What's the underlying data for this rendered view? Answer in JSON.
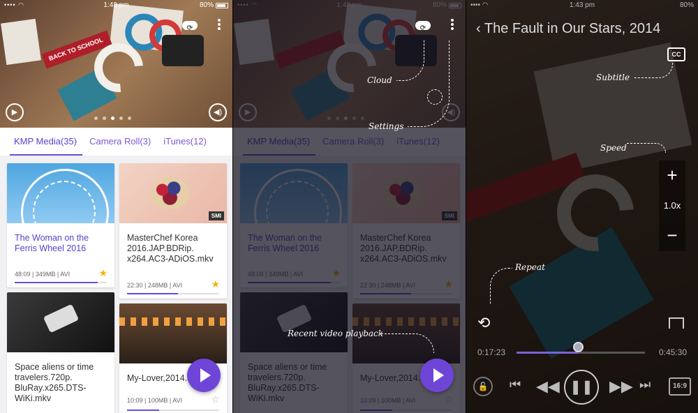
{
  "status": {
    "time": "1:43 pm",
    "battery": "80%"
  },
  "library": {
    "tabs": [
      {
        "label": "KMP Media",
        "count": "(35)"
      },
      {
        "label": "Camera Roll",
        "count": "(3)"
      },
      {
        "label": "iTunes",
        "count": "(12)"
      }
    ],
    "cards": [
      {
        "title": "The Woman on the Ferris Wheel 2016",
        "duration": "48:09",
        "size": "349MB",
        "format": "AVI",
        "starred": true,
        "progress": 0.9,
        "badge": ""
      },
      {
        "title": "MasterChef Korea 2016.JAP.BDRip. x264.AC3-ADiOS.mkv",
        "duration": "22:30",
        "size": "248MB",
        "format": "AVI",
        "starred": true,
        "progress": 0.55,
        "badge": "SMI"
      },
      {
        "title": "Space aliens or time travelers.720p. BluRay.x265.DTS-WiKi.mkv",
        "duration": "",
        "size": "",
        "format": "",
        "starred": false,
        "progress": 0,
        "badge": ""
      },
      {
        "title": "My-Lover,2014.a",
        "duration": "10:09",
        "size": "100MB",
        "format": "AVI",
        "starred": false,
        "progress": 0.35,
        "badge": ""
      }
    ],
    "hero_pennant": "BACK TO SCHOOL"
  },
  "guide": {
    "cloud": "Cloud",
    "settings": "Settings",
    "recent": "Recent video playback"
  },
  "player": {
    "title": "The Fault in Our Stars, 2014",
    "cc_label": "CC",
    "subtitle_hint": "Subtitle",
    "speed_hint": "Speed",
    "repeat_hint": "Repeat",
    "speed_value": "1.0x",
    "elapsed": "0:17:23",
    "remaining": "0:45:30",
    "progress": 0.48,
    "ratio_label": "16:9"
  },
  "colors": {
    "accent": "#6d4ad8",
    "fab": "#6f45d8",
    "star": "#f5b400"
  }
}
